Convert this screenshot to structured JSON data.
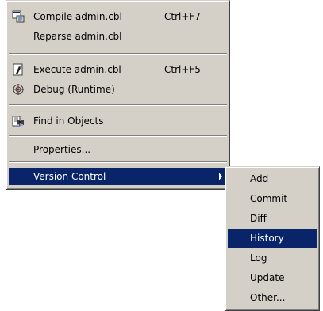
{
  "context_menu": {
    "items": [
      {
        "label": "Compile  admin.cbl",
        "shortcut": "Ctrl+F7",
        "icon": "compile-icon"
      },
      {
        "label": "Reparse  admin.cbl",
        "shortcut": "",
        "icon": ""
      },
      {
        "label": "Execute  admin.cbl",
        "shortcut": "Ctrl+F5",
        "icon": "execute-icon"
      },
      {
        "label": "Debug (Runtime)",
        "shortcut": "",
        "icon": "debug-icon"
      },
      {
        "label": "Find in Objects",
        "shortcut": "",
        "icon": "find-icon"
      },
      {
        "label": "Properties...",
        "shortcut": "",
        "icon": ""
      },
      {
        "label": "Version Control",
        "shortcut": "",
        "icon": "",
        "has_submenu": true,
        "selected": true
      }
    ]
  },
  "version_control_submenu": {
    "items": [
      {
        "label": "Add"
      },
      {
        "label": "Commit"
      },
      {
        "label": "Diff"
      },
      {
        "label": "History",
        "selected": true
      },
      {
        "label": "Log"
      },
      {
        "label": "Update"
      },
      {
        "label": "Other..."
      }
    ]
  },
  "colors": {
    "menu_background": "#d4d0c8",
    "selection_background": "#0a246a",
    "selection_text": "#ffffff"
  }
}
